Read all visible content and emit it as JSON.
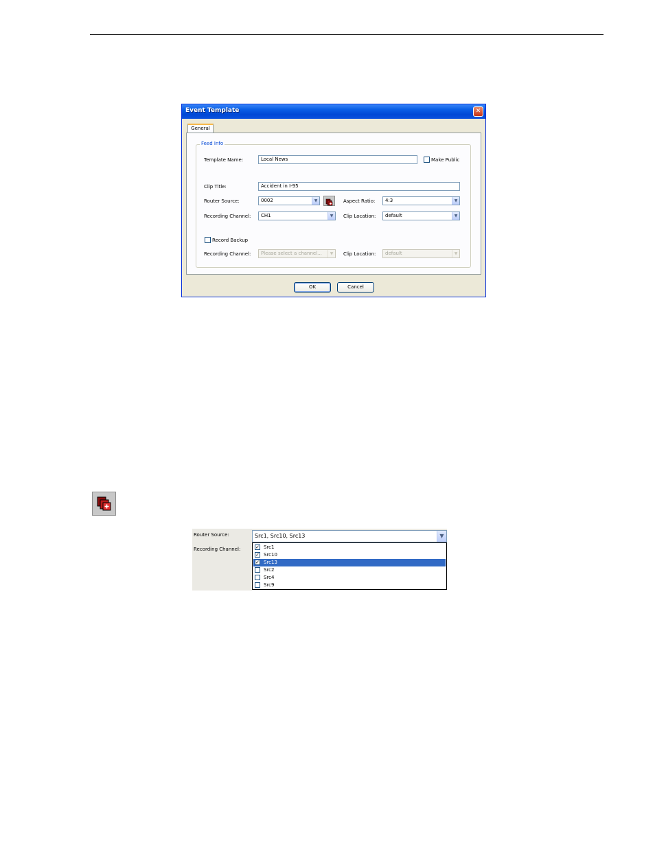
{
  "dialog": {
    "title": "Event Template",
    "close_glyph": "✕",
    "tab_general": "General",
    "group_title": "Feed Info",
    "template_name_label": "Template Name:",
    "template_name_value": "Local News",
    "make_public_label": "Make Public",
    "make_public_checked": false,
    "clip_title_label": "Clip Title:",
    "clip_title_value": "Accident in I-95",
    "router_source_label": "Router Source:",
    "router_source_value": "0002",
    "multi_select_icon": "multi-source-icon",
    "aspect_ratio_label": "Aspect Ratio:",
    "aspect_ratio_value": "4:3",
    "recording_channel_label": "Recording Channel:",
    "recording_channel_value": "CH1",
    "clip_location_label": "Clip Location:",
    "clip_location_value": "default",
    "record_backup_label": "Record Backup",
    "record_backup_checked": false,
    "backup_recording_channel_label": "Recording Channel:",
    "backup_recording_channel_placeholder": "Please select a channel...",
    "backup_clip_location_label": "Clip Location:",
    "backup_clip_location_value": "default",
    "ok_label": "OK",
    "cancel_label": "Cancel"
  },
  "standalone_icon": "multi-source-icon",
  "dropdown_example": {
    "router_source_label": "Router Source:",
    "router_source_value": "Src1, Src10, Src13",
    "recording_channel_label": "Recording Channel:",
    "items": [
      {
        "label": "Src1",
        "checked": true,
        "selected": false
      },
      {
        "label": "Src10",
        "checked": true,
        "selected": false
      },
      {
        "label": "Src13",
        "checked": true,
        "selected": true
      },
      {
        "label": "Src2",
        "checked": false,
        "selected": false
      },
      {
        "label": "Src4",
        "checked": false,
        "selected": false
      },
      {
        "label": "Src9",
        "checked": false,
        "selected": false
      }
    ]
  },
  "colors": {
    "titlebar": "#0a5fe6",
    "dialog_bg": "#ece9d8",
    "selection": "#316ac5",
    "group_title": "#0046d5"
  }
}
